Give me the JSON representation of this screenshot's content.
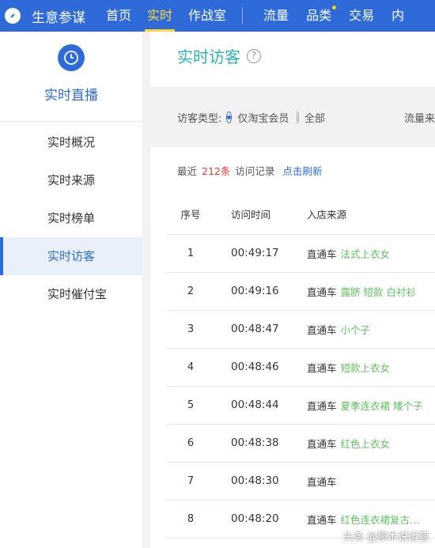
{
  "app": {
    "name": "生意参谋"
  },
  "nav": [
    "首页",
    "实时",
    "作战室",
    "流量",
    "品类",
    "交易",
    "内"
  ],
  "sidebar": {
    "title": "实时直播",
    "items": [
      "实时概况",
      "实时来源",
      "实时榜单",
      "实时访客",
      "实时催付宝"
    ]
  },
  "page": {
    "title": "实时访客",
    "help": "?"
  },
  "filter": {
    "label": "访客类型:",
    "opt1": "仅淘宝会员",
    "opt2": "全部",
    "right_label": "流量来"
  },
  "summary": {
    "prefix": "最近",
    "count": "212条",
    "suffix": "访问记录",
    "refresh": "点击刷新"
  },
  "table": {
    "headers": [
      "序号",
      "访问时间",
      "入店来源"
    ],
    "rows": [
      {
        "n": "1",
        "time": "00:49:17",
        "src": "直通车",
        "kw": "法式上衣女"
      },
      {
        "n": "2",
        "time": "00:49:16",
        "src": "直通车",
        "kw": "露脐 短款 白衬衫"
      },
      {
        "n": "3",
        "time": "00:48:47",
        "src": "直通车",
        "kw": "小个子"
      },
      {
        "n": "4",
        "time": "00:48:46",
        "src": "直通车",
        "kw": "短款上衣女"
      },
      {
        "n": "5",
        "time": "00:48:44",
        "src": "直通车",
        "kw": "夏季连衣裙 矮个子"
      },
      {
        "n": "6",
        "time": "00:48:38",
        "src": "直通车",
        "kw": "红色上衣女"
      },
      {
        "n": "7",
        "time": "00:48:30",
        "src": "直通车",
        "kw": ""
      },
      {
        "n": "8",
        "time": "00:48:20",
        "src": "直通车",
        "kw": "红色连衣裙复古…"
      }
    ]
  },
  "watermark": "头条 @那木说运营",
  "colors": {
    "brand": "#2e6bd8",
    "active_nav": "#ffd633",
    "title": "#2cb3b3",
    "count": "#e53b3b",
    "keyword": "#5cc25c"
  },
  "icons": {
    "logo": "compass-icon",
    "sidebar": "clock-icon",
    "help": "question-icon"
  }
}
